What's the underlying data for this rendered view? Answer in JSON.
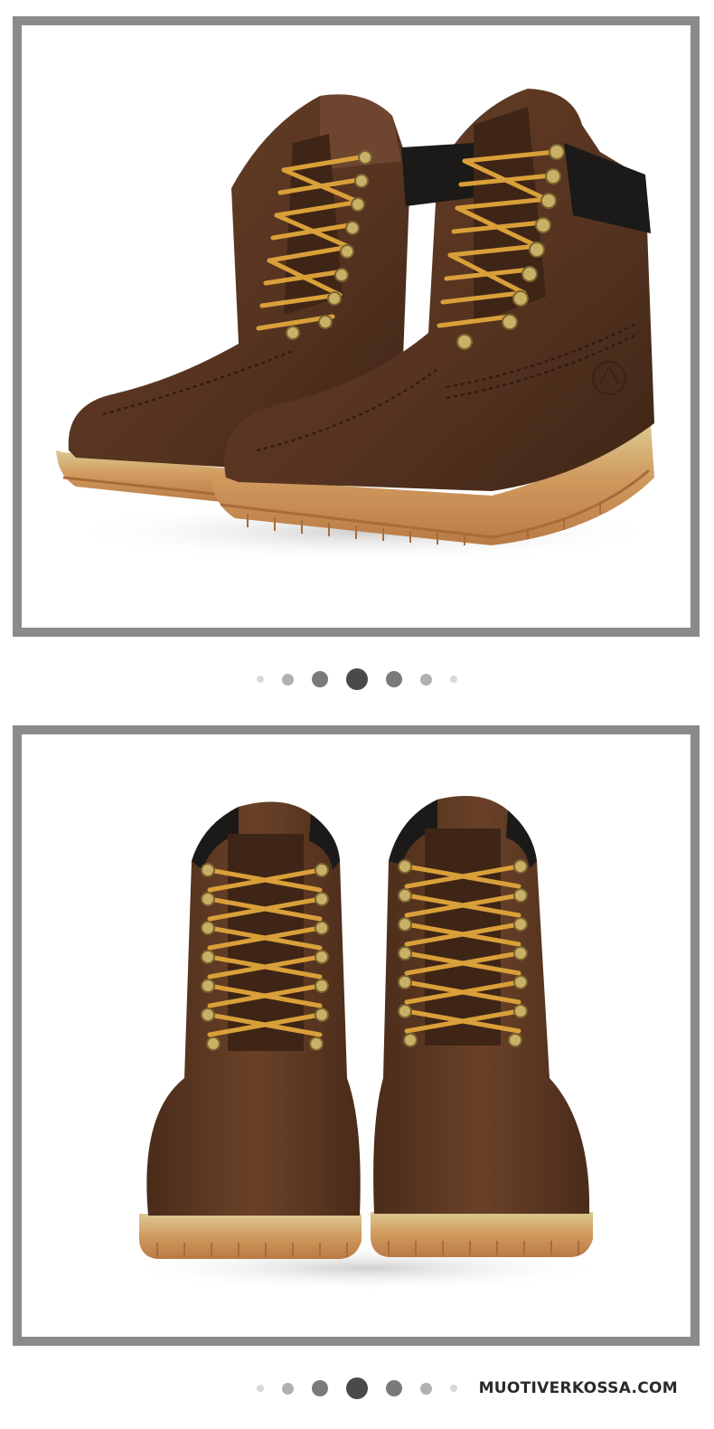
{
  "watermark": {
    "text": "MUOTIVERKOSSA.COM"
  },
  "carousel_1": {
    "dot_count": 7,
    "active_index": 3
  },
  "carousel_2": {
    "dot_count": 7,
    "active_index": 3
  },
  "colors": {
    "frame": "#8a8a8a",
    "boot_leather": "#5a3722",
    "boot_leather_dark": "#3b2314",
    "collar": "#1c1a18",
    "lace": "#d9a03a",
    "sole": "#c98f55",
    "welt": "#d8c48a",
    "eyelet": "#c9b067"
  }
}
